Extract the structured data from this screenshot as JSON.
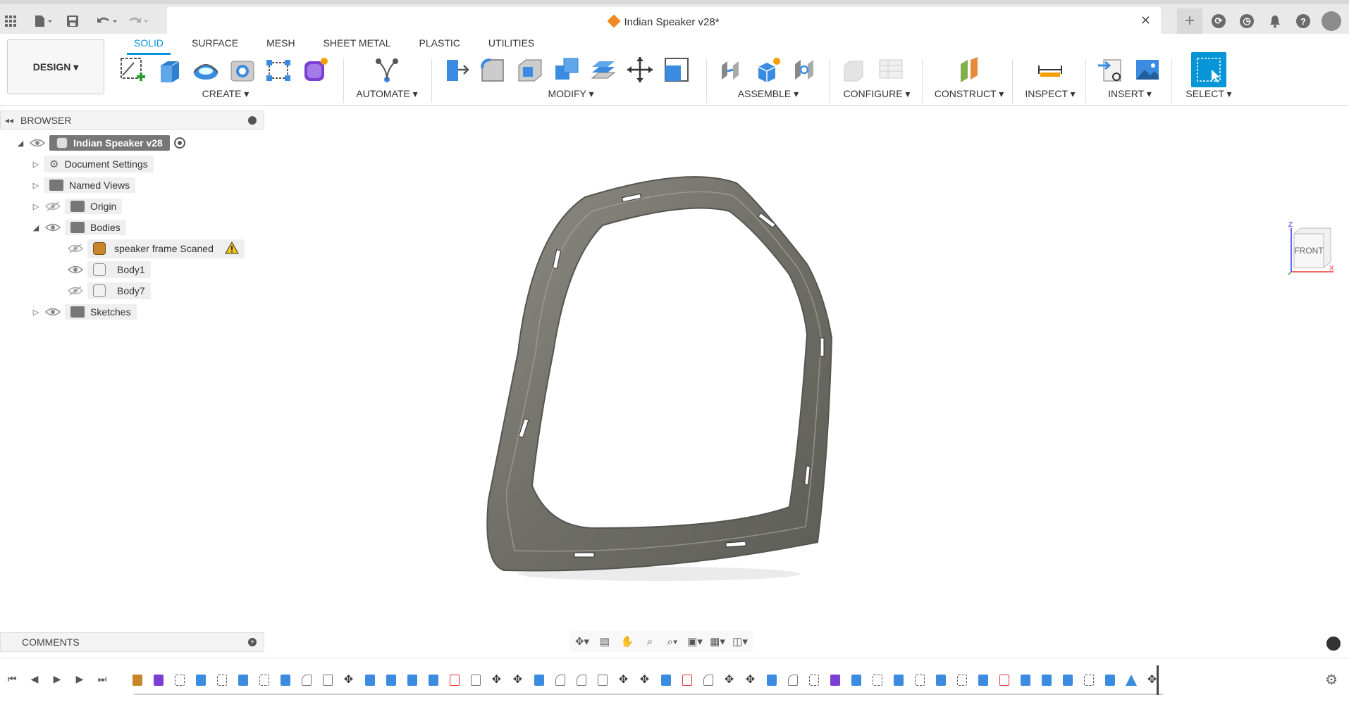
{
  "document": {
    "title": "Indian Speaker v28*"
  },
  "workspace": {
    "label": "DESIGN ▾"
  },
  "tabs": [
    {
      "label": "SOLID",
      "active": true
    },
    {
      "label": "SURFACE"
    },
    {
      "label": "MESH"
    },
    {
      "label": "SHEET METAL"
    },
    {
      "label": "PLASTIC"
    },
    {
      "label": "UTILITIES"
    }
  ],
  "groups": {
    "create": "CREATE ▾",
    "automate": "AUTOMATE ▾",
    "modify": "MODIFY ▾",
    "assemble": "ASSEMBLE ▾",
    "configure": "CONFIGURE ▾",
    "construct": "CONSTRUCT ▾",
    "inspect": "INSPECT ▾",
    "insert": "INSERT ▾",
    "select": "SELECT ▾"
  },
  "browser": {
    "title": "BROWSER",
    "root": "Indian Speaker v28",
    "items": [
      {
        "label": "Document Settings"
      },
      {
        "label": "Named Views"
      },
      {
        "label": "Origin"
      },
      {
        "label": "Bodies"
      },
      {
        "label": "speaker frame Scaned"
      },
      {
        "label": "Body1"
      },
      {
        "label": "Body7"
      },
      {
        "label": "Sketches"
      }
    ]
  },
  "viewcube": {
    "face": "FRONT",
    "axis_z": "Z",
    "axis_x": "X"
  },
  "comments": {
    "label": "COMMENTS"
  },
  "colors": {
    "accent": "#0696d7",
    "body": "#7a7a72",
    "warning": "#f5c518"
  }
}
